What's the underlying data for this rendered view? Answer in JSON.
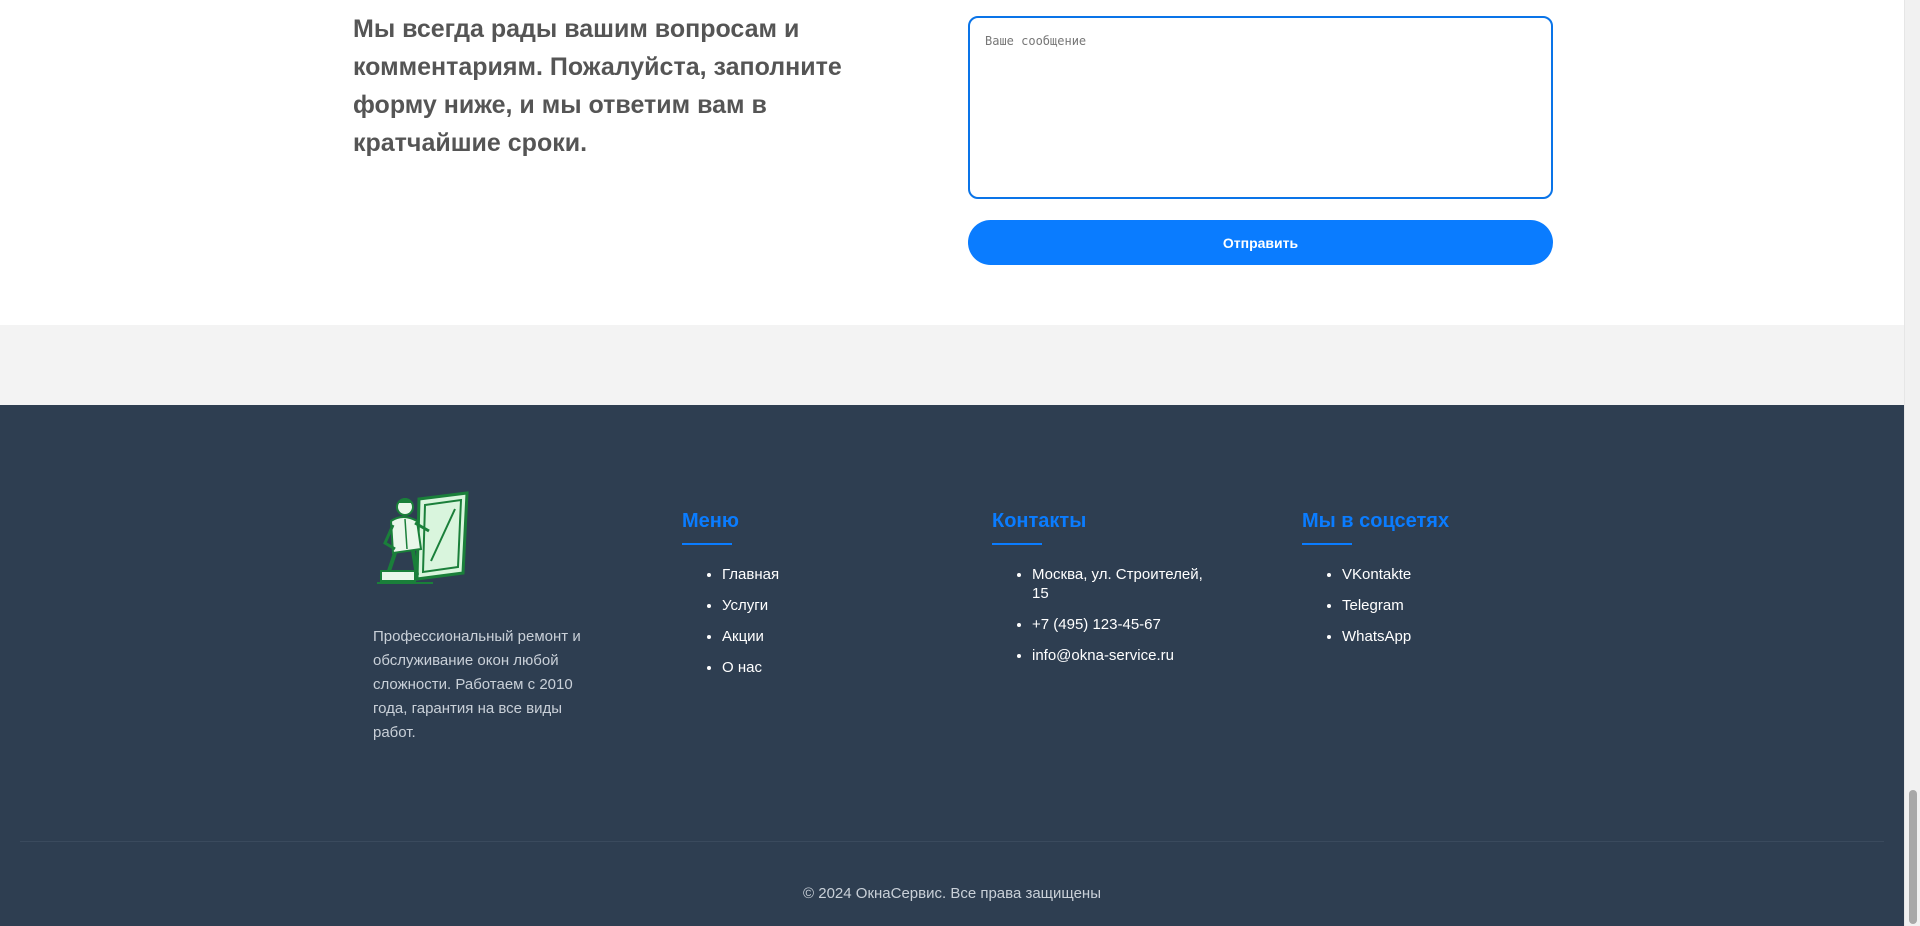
{
  "contact": {
    "intro_text": "Мы всегда рады вашим вопросам и комментариям. Пожалуйста, заполните форму ниже, и мы ответим вам в кратчайшие сроки.",
    "message_placeholder": "Ваше сообщение",
    "submit_label": "Отправить"
  },
  "footer": {
    "logo_icon": "window-installer-logo",
    "about_text": "Профессиональный ремонт и обслуживание окон любой сложности. Работаем с 2010 года, гарантия на все виды работ.",
    "menu": {
      "title": "Меню",
      "items": [
        {
          "label": "Главная"
        },
        {
          "label": "Услуги"
        },
        {
          "label": "Акции"
        },
        {
          "label": "О нас"
        }
      ]
    },
    "contacts": {
      "title": "Контакты",
      "items": [
        {
          "label": "Москва, ул. Строителей, 15"
        },
        {
          "label": "+7 (495) 123-45-67"
        },
        {
          "label": "info@okna-service.ru"
        }
      ]
    },
    "social": {
      "title": "Мы в соцсетях",
      "items": [
        {
          "label": "VKontakte"
        },
        {
          "label": "Telegram"
        },
        {
          "label": "WhatsApp"
        }
      ]
    },
    "copyright": "© 2024 ОкнаСервис. Все права защищены"
  },
  "colors": {
    "accent": "#0a7cff",
    "footer_bg": "#2e3e51",
    "band_bg": "#f3f3f3",
    "intro_text": "#555555"
  }
}
